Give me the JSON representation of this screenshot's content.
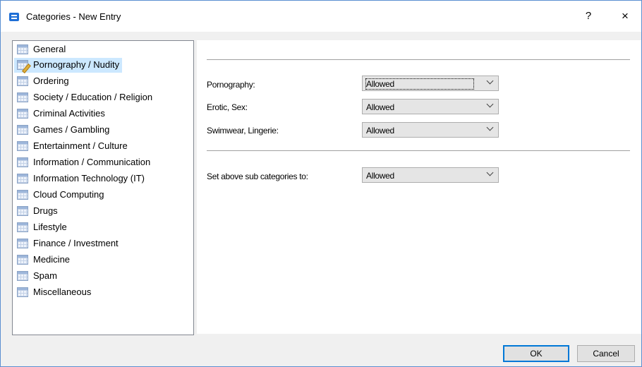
{
  "window": {
    "title": "Categories - New Entry",
    "help_label": "?",
    "close_label": "×",
    "accent_color": "#0078d7"
  },
  "tree": {
    "items": [
      {
        "label": "General",
        "icon": "grid-table-icon"
      },
      {
        "label": "Pornography / Nudity",
        "icon": "grid-edit-icon",
        "selected": true
      },
      {
        "label": "Ordering",
        "icon": "grid-table-icon"
      },
      {
        "label": "Society / Education / Religion",
        "icon": "grid-table-icon"
      },
      {
        "label": "Criminal Activities",
        "icon": "grid-table-icon"
      },
      {
        "label": "Games / Gambling",
        "icon": "grid-table-icon"
      },
      {
        "label": "Entertainment / Culture",
        "icon": "grid-table-icon"
      },
      {
        "label": "Information / Communication",
        "icon": "grid-table-icon"
      },
      {
        "label": "Information Technology (IT)",
        "icon": "grid-table-icon"
      },
      {
        "label": "Cloud Computing",
        "icon": "grid-table-icon"
      },
      {
        "label": "Drugs",
        "icon": "grid-table-icon"
      },
      {
        "label": "Lifestyle",
        "icon": "grid-table-icon"
      },
      {
        "label": "Finance / Investment",
        "icon": "grid-table-icon"
      },
      {
        "label": "Medicine",
        "icon": "grid-table-icon"
      },
      {
        "label": "Spam",
        "icon": "grid-table-icon"
      },
      {
        "label": "Miscellaneous",
        "icon": "grid-table-icon"
      }
    ]
  },
  "panel": {
    "fields": [
      {
        "label": "Pornography:",
        "value": "Allowed"
      },
      {
        "label": "Erotic, Sex:",
        "value": "Allowed"
      },
      {
        "label": "Swimwear, Lingerie:",
        "value": "Allowed"
      }
    ],
    "set_all": {
      "label": "Set above sub categories to:",
      "value": "Allowed"
    }
  },
  "buttons": {
    "ok_label": "OK",
    "cancel_label": "Cancel"
  }
}
